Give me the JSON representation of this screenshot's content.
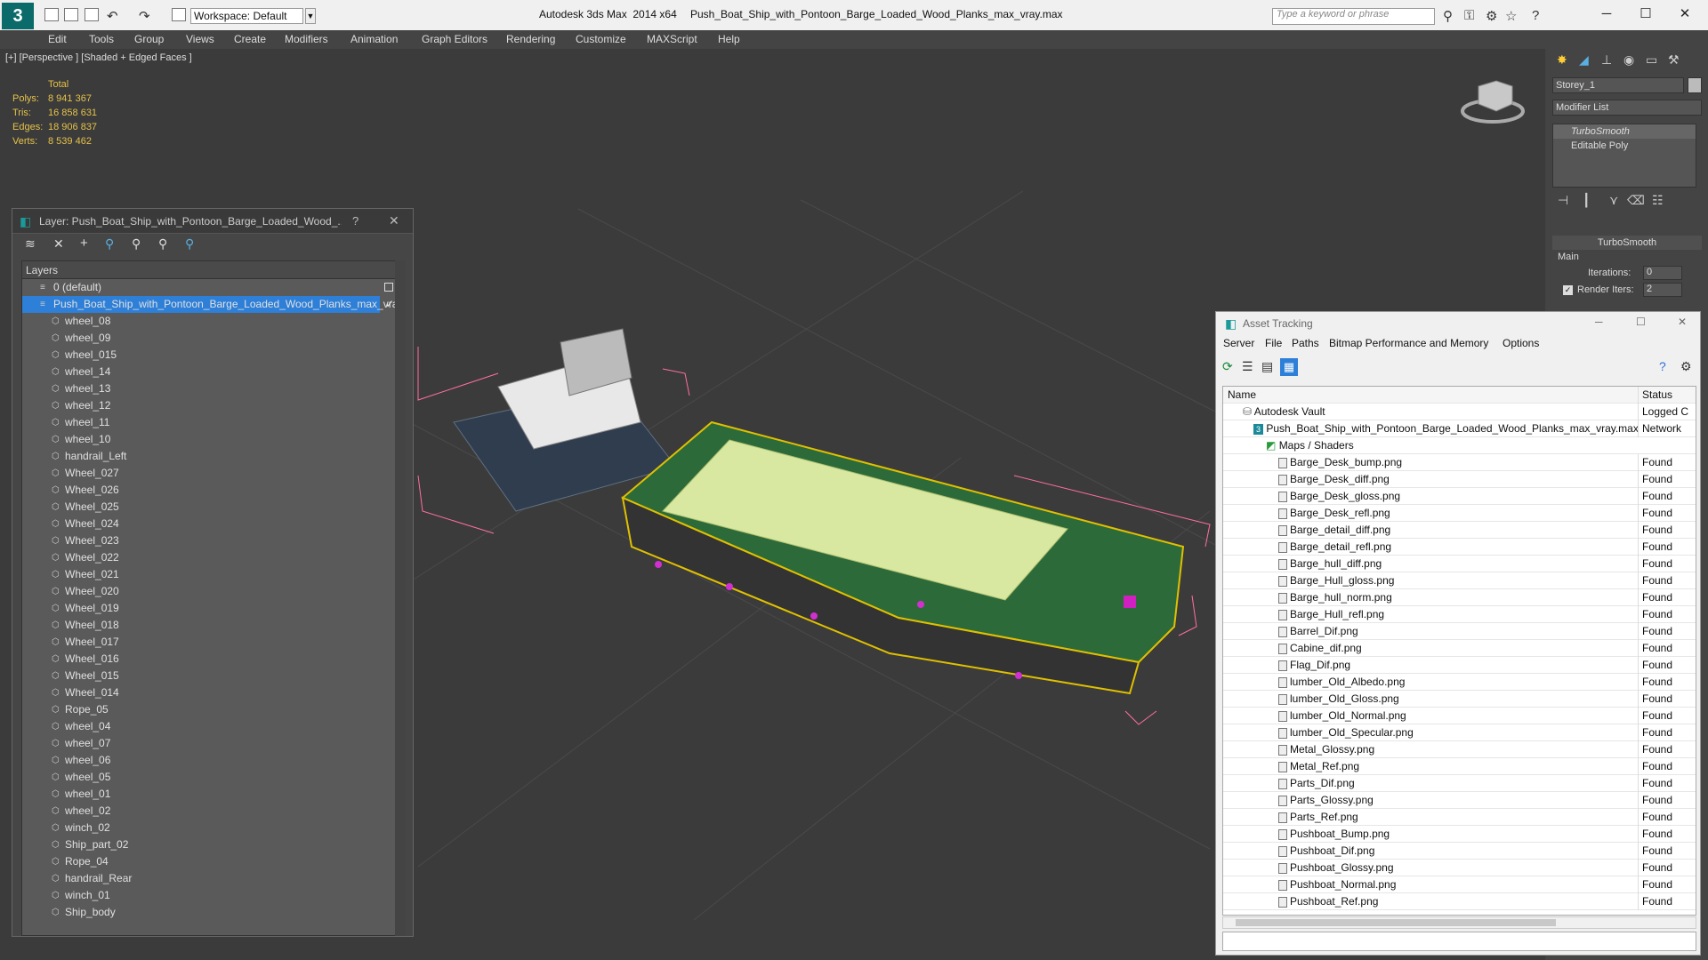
{
  "window": {
    "app_title": "Autodesk 3ds Max  2014 x64",
    "file_title": "Push_Boat_Ship_with_Pontoon_Barge_Loaded_Wood_Planks_max_vray.max",
    "workspace": "Workspace: Default",
    "search_placeholder": "Type a keyword or phrase"
  },
  "menu": [
    "Edit",
    "Tools",
    "Group",
    "Views",
    "Create",
    "Modifiers",
    "Animation",
    "Graph Editors",
    "Rendering",
    "Customize",
    "MAXScript",
    "Help"
  ],
  "viewport": {
    "label": "[+] [Perspective ] [Shaded + Edged Faces ]",
    "stats": {
      "header": "Total",
      "rows": [
        {
          "k": "Polys:",
          "v": "8 941 367"
        },
        {
          "k": "Tris:",
          "v": "16 858 631"
        },
        {
          "k": "Edges:",
          "v": "18 906 837"
        },
        {
          "k": "Verts:",
          "v": "8 539 462"
        }
      ]
    }
  },
  "command_panel": {
    "object_name": "Storey_1",
    "modifier_list": "Modifier List",
    "stack": [
      "TurboSmooth",
      "Editable Poly"
    ],
    "rollout_title": "TurboSmooth",
    "group": "Main",
    "iterations_label": "Iterations:",
    "iterations_value": "0",
    "render_iters_label": "Render Iters:",
    "render_iters_value": "2"
  },
  "layer_window": {
    "title": "Layer: Push_Boat_Ship_with_Pontoon_Barge_Loaded_Wood_...",
    "help": "?",
    "column": "Layers",
    "default_layer": "0 (default)",
    "active_layer": "Push_Boat_Ship_with_Pontoon_Barge_Loaded_Wood_Planks_max_vray",
    "items": [
      "wheel_08",
      "wheel_09",
      "wheel_015",
      "wheel_14",
      "wheel_13",
      "wheel_12",
      "wheel_11",
      "wheel_10",
      "handrail_Left",
      "Wheel_027",
      "Wheel_026",
      "Wheel_025",
      "Wheel_024",
      "Wheel_023",
      "Wheel_022",
      "Wheel_021",
      "Wheel_020",
      "Wheel_019",
      "Wheel_018",
      "Wheel_017",
      "Wheel_016",
      "Wheel_015",
      "Wheel_014",
      "Rope_05",
      "wheel_04",
      "wheel_07",
      "wheel_06",
      "wheel_05",
      "wheel_01",
      "wheel_02",
      "winch_02",
      "Ship_part_02",
      "Rope_04",
      "handrail_Rear",
      "winch_01",
      "Ship_body"
    ]
  },
  "asset_window": {
    "title": "Asset Tracking",
    "menu": [
      "Server",
      "File",
      "Paths",
      "Bitmap Performance and Memory",
      "Options"
    ],
    "col_name": "Name",
    "col_status": "Status",
    "vault": {
      "name": "Autodesk Vault",
      "status": "Logged C"
    },
    "file": {
      "name": "Push_Boat_Ship_with_Pontoon_Barge_Loaded_Wood_Planks_max_vray.max",
      "status": "Network"
    },
    "maps_group": "Maps / Shaders",
    "maps": [
      {
        "name": "Barge_Desk_bump.png",
        "status": "Found"
      },
      {
        "name": "Barge_Desk_diff.png",
        "status": "Found"
      },
      {
        "name": "Barge_Desk_gloss.png",
        "status": "Found"
      },
      {
        "name": "Barge_Desk_refl.png",
        "status": "Found"
      },
      {
        "name": "Barge_detail_diff.png",
        "status": "Found"
      },
      {
        "name": "Barge_detail_refl.png",
        "status": "Found"
      },
      {
        "name": "Barge_hull_diff.png",
        "status": "Found"
      },
      {
        "name": "Barge_Hull_gloss.png",
        "status": "Found"
      },
      {
        "name": "Barge_hull_norm.png",
        "status": "Found"
      },
      {
        "name": "Barge_Hull_refl.png",
        "status": "Found"
      },
      {
        "name": "Barrel_Dif.png",
        "status": "Found"
      },
      {
        "name": "Cabine_dif.png",
        "status": "Found"
      },
      {
        "name": "Flag_Dif.png",
        "status": "Found"
      },
      {
        "name": "lumber_Old_Albedo.png",
        "status": "Found"
      },
      {
        "name": "lumber_Old_Gloss.png",
        "status": "Found"
      },
      {
        "name": "lumber_Old_Normal.png",
        "status": "Found"
      },
      {
        "name": "lumber_Old_Specular.png",
        "status": "Found"
      },
      {
        "name": "Metal_Glossy.png",
        "status": "Found"
      },
      {
        "name": "Metal_Ref.png",
        "status": "Found"
      },
      {
        "name": "Parts_Dif.png",
        "status": "Found"
      },
      {
        "name": "Parts_Glossy.png",
        "status": "Found"
      },
      {
        "name": "Parts_Ref.png",
        "status": "Found"
      },
      {
        "name": "Pushboat_Bump.png",
        "status": "Found"
      },
      {
        "name": "Pushboat_Dif.png",
        "status": "Found"
      },
      {
        "name": "Pushboat_Glossy.png",
        "status": "Found"
      },
      {
        "name": "Pushboat_Normal.png",
        "status": "Found"
      },
      {
        "name": "Pushboat_Ref.png",
        "status": "Found"
      }
    ]
  }
}
